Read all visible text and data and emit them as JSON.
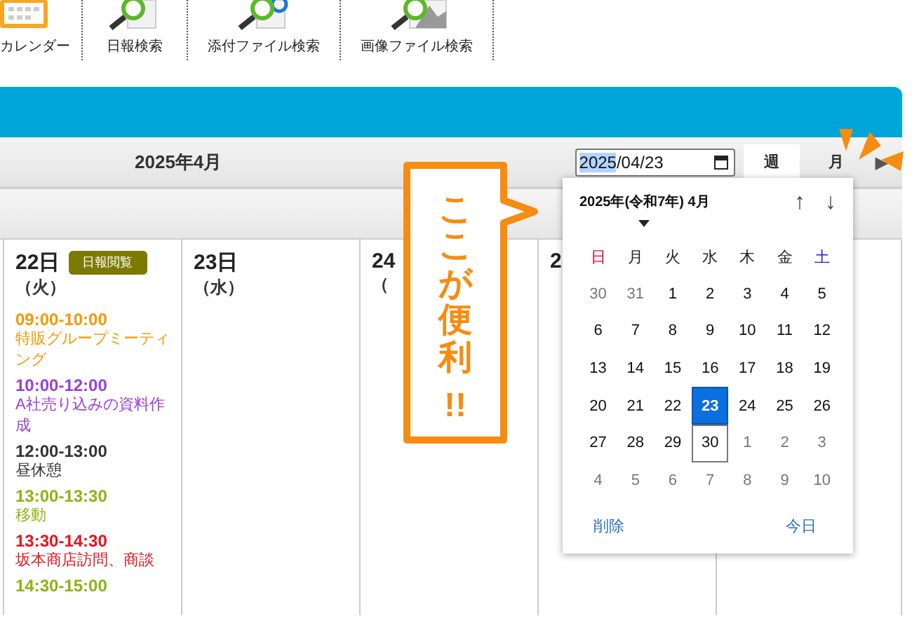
{
  "toolbar": [
    {
      "label": "カレンダー",
      "kind": "calendar"
    },
    {
      "label": "日報検索",
      "kind": "search"
    },
    {
      "label": "添付ファイル検索",
      "kind": "attach"
    },
    {
      "label": "画像ファイル検索",
      "kind": "image"
    }
  ],
  "header": {
    "title": "2025年4月",
    "date_field": {
      "segments": [
        {
          "text": "2025",
          "selected": true
        },
        {
          "text": "/04/23",
          "selected": false
        }
      ]
    },
    "views": [
      {
        "label": "週",
        "selected": true
      },
      {
        "label": "月",
        "selected": false
      }
    ],
    "next": "▶"
  },
  "days": [
    {
      "date": "22日",
      "weekday": "（火）",
      "badge": "日報閲覧",
      "events": [
        {
          "time": "09:00-10:00",
          "title": "特販グループミーティング",
          "color": "#f39800"
        },
        {
          "time": "10:00-12:00",
          "title": "A社売り込みの資料作成",
          "color": "#9b3fd6"
        },
        {
          "time": "12:00-13:00",
          "title": "昼休憩",
          "color": "#333333"
        },
        {
          "time": "13:00-13:30",
          "title": "移動",
          "color": "#8cb414"
        },
        {
          "time": "13:30-14:30",
          "title": "坂本商店訪問、商談",
          "color": "#e6141e"
        },
        {
          "time": "14:30-15:00",
          "color": "#8cb414"
        }
      ]
    },
    {
      "date": "23日",
      "weekday": "（水）"
    },
    {
      "date": "24",
      "weekday": "（"
    },
    {
      "date": "2"
    }
  ],
  "picker": {
    "title": "2025年(令和7年) 4月",
    "up": "↑",
    "down": "↓",
    "weekdays": [
      {
        "label": "日",
        "color": "#e60033"
      },
      {
        "label": "月",
        "color": "#222222"
      },
      {
        "label": "火",
        "color": "#222222"
      },
      {
        "label": "水",
        "color": "#222222"
      },
      {
        "label": "木",
        "color": "#222222"
      },
      {
        "label": "金",
        "color": "#222222"
      },
      {
        "label": "土",
        "color": "#2020e0"
      }
    ],
    "days": [
      {
        "label": "30",
        "outside": true,
        "selected": false,
        "today": false
      },
      {
        "label": "31",
        "outside": true,
        "selected": false,
        "today": false
      },
      {
        "label": "1",
        "outside": false,
        "selected": false,
        "today": false
      },
      {
        "label": "2",
        "outside": false,
        "selected": false,
        "today": false
      },
      {
        "label": "3",
        "outside": false,
        "selected": false,
        "today": false
      },
      {
        "label": "4",
        "outside": false,
        "selected": false,
        "today": false
      },
      {
        "label": "5",
        "outside": false,
        "selected": false,
        "today": false
      },
      {
        "label": "6",
        "outside": false,
        "selected": false,
        "today": false
      },
      {
        "label": "7",
        "outside": false,
        "selected": false,
        "today": false
      },
      {
        "label": "8",
        "outside": false,
        "selected": false,
        "today": false
      },
      {
        "label": "9",
        "outside": false,
        "selected": false,
        "today": false
      },
      {
        "label": "10",
        "outside": false,
        "selected": false,
        "today": false
      },
      {
        "label": "11",
        "outside": false,
        "selected": false,
        "today": false
      },
      {
        "label": "12",
        "outside": false,
        "selected": false,
        "today": false
      },
      {
        "label": "13",
        "outside": false,
        "selected": false,
        "today": false
      },
      {
        "label": "14",
        "outside": false,
        "selected": false,
        "today": false
      },
      {
        "label": "15",
        "outside": false,
        "selected": false,
        "today": false
      },
      {
        "label": "16",
        "outside": false,
        "selected": false,
        "today": false
      },
      {
        "label": "17",
        "outside": false,
        "selected": false,
        "today": false
      },
      {
        "label": "18",
        "outside": false,
        "selected": false,
        "today": false
      },
      {
        "label": "19",
        "outside": false,
        "selected": false,
        "today": false
      },
      {
        "label": "20",
        "outside": false,
        "selected": false,
        "today": false
      },
      {
        "label": "21",
        "outside": false,
        "selected": false,
        "today": false
      },
      {
        "label": "22",
        "outside": false,
        "selected": false,
        "today": false
      },
      {
        "label": "23",
        "outside": false,
        "selected": true,
        "today": false
      },
      {
        "label": "24",
        "outside": false,
        "selected": false,
        "today": false
      },
      {
        "label": "25",
        "outside": false,
        "selected": false,
        "today": false
      },
      {
        "label": "26",
        "outside": false,
        "selected": false,
        "today": false
      },
      {
        "label": "27",
        "outside": false,
        "selected": false,
        "today": false
      },
      {
        "label": "28",
        "outside": false,
        "selected": false,
        "today": false
      },
      {
        "label": "29",
        "outside": false,
        "selected": false,
        "today": false
      },
      {
        "label": "30",
        "outside": false,
        "selected": false,
        "today": true
      },
      {
        "label": "1",
        "outside": true,
        "selected": false,
        "today": false
      },
      {
        "label": "2",
        "outside": true,
        "selected": false,
        "today": false
      },
      {
        "label": "3",
        "outside": true,
        "selected": false,
        "today": false
      },
      {
        "label": "4",
        "outside": true,
        "selected": false,
        "today": false
      },
      {
        "label": "5",
        "outside": true,
        "selected": false,
        "today": false
      },
      {
        "label": "6",
        "outside": true,
        "selected": false,
        "today": false
      },
      {
        "label": "7",
        "outside": true,
        "selected": false,
        "today": false
      },
      {
        "label": "8",
        "outside": true,
        "selected": false,
        "today": false
      },
      {
        "label": "9",
        "outside": true,
        "selected": false,
        "today": false
      },
      {
        "label": "10",
        "outside": true,
        "selected": false,
        "today": false
      }
    ],
    "clear": "削除",
    "today": "今日"
  },
  "callout": {
    "text": "ここが便利",
    "emphasis": "!!"
  }
}
